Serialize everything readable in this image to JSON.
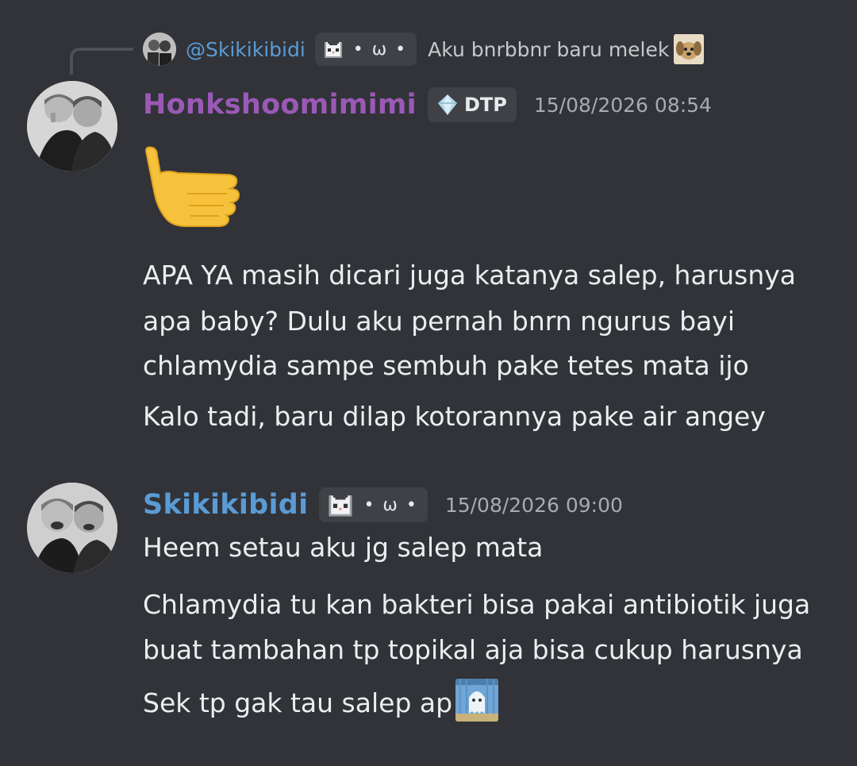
{
  "reply": {
    "author": "@Skikikibidi",
    "tag_text": "• ω •",
    "content": "Aku bnrbbnr baru melek"
  },
  "messages": [
    {
      "author": "Honkshoomimimi",
      "author_color": "#9b59b6",
      "tag_text": "DTP",
      "timestamp": "15/08/2026 08:54",
      "lines": [
        "APA YA masih dicari juga katanya salep, harusnya",
        "apa baby? Dulu aku pernah bnrn ngurus bayi",
        "chlamydia sampe sembuh pake tetes mata ijo",
        "Kalo tadi, baru dilap kotorannya pake air angey"
      ]
    },
    {
      "author": "Skikikibidi",
      "author_color": "#5b9bd5",
      "tag_text": "• ω •",
      "timestamp": "15/08/2026 09:00",
      "lines": [
        "Heem setau aku jg salep mata",
        "Chlamydia tu kan bakteri bisa pakai antibiotik juga",
        "buat tambahan tp topikal aja bisa cukup harusnya",
        "Sek tp gak tau salep ap"
      ]
    }
  ],
  "icons": {
    "reply_avatar": "user-avatar-icon",
    "cat_tag": "pixel-cat-icon",
    "dog_emoji": "puppy-emoji-icon",
    "diamond_tag": "diamond-icon",
    "pointing_emoji": "pointing-hand-emoji",
    "ghost_emoji": "ghost-sticker-icon"
  },
  "colors": {
    "background": "#313338",
    "tag_background": "#3f4147",
    "link_blue": "#5b9bd5",
    "role_purple": "#9b59b6",
    "timestamp": "#a9abb1",
    "text": "#ecedef"
  }
}
